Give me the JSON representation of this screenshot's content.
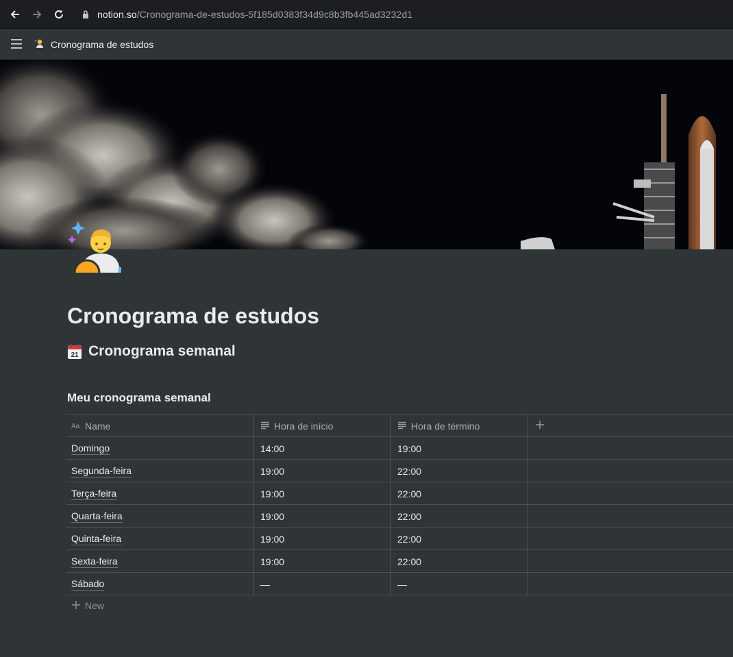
{
  "browser": {
    "url_host": "notion.so",
    "url_path": "/Cronograma-de-estudos-5f185d0383f34d9c8b3fb445ad3232d1"
  },
  "topbar": {
    "page_icon": "astronaut-emoji-icon",
    "breadcrumb_title": "Cronograma de estudos"
  },
  "page": {
    "title": "Cronograma de estudos",
    "section_heading": "Cronograma semanal",
    "section_icon": "calendar-icon",
    "database_title": "Meu cronograma semanal"
  },
  "table": {
    "columns": [
      {
        "label": "Name",
        "icon": "title-property-icon"
      },
      {
        "label": "Hora de início",
        "icon": "text-property-icon"
      },
      {
        "label": "Hora de término",
        "icon": "text-property-icon"
      }
    ],
    "rows": [
      {
        "name": "Domingo",
        "start": "14:00",
        "end": "19:00"
      },
      {
        "name": "Segunda-feira",
        "start": "19:00",
        "end": "22:00"
      },
      {
        "name": "Terça-feira",
        "start": "19:00",
        "end": "22:00"
      },
      {
        "name": "Quarta-feira",
        "start": "19:00",
        "end": "22:00"
      },
      {
        "name": "Quinta-feira",
        "start": "19:00",
        "end": "22:00"
      },
      {
        "name": "Sexta-feira",
        "start": "19:00",
        "end": "22:00"
      },
      {
        "name": "Sábado",
        "start": "—",
        "end": "—"
      }
    ],
    "new_label": "New"
  },
  "colors": {
    "background": "#2f3437",
    "browser_bar": "#1d1e22"
  }
}
